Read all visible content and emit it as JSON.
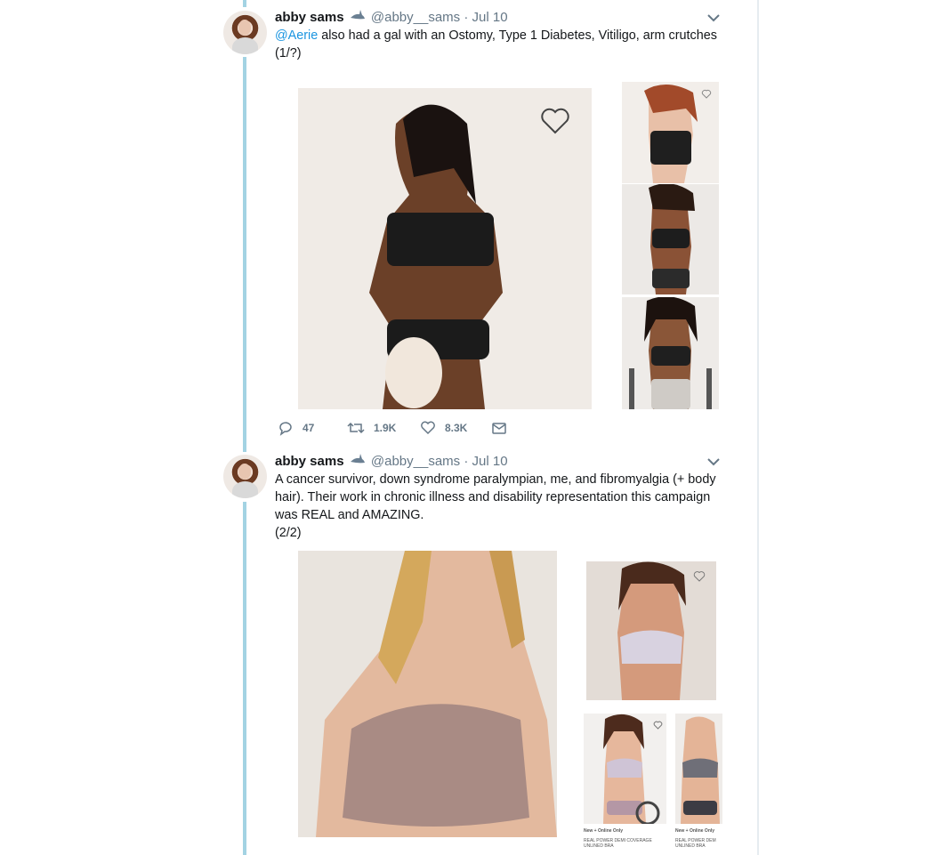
{
  "tweets": [
    {
      "name": "abby sams",
      "emoji": "shark-emoji",
      "handle": "@abby__sams",
      "separator": "·",
      "date": "Jul 10",
      "mention": "@Aerie",
      "text_after_mention": " also had a gal with an Ostomy, Type 1 Diabetes, Vitiligo, arm crutches",
      "text_line2": "(1/?)",
      "actions": {
        "replies": "47",
        "retweets": "1.9K",
        "likes": "8.3K"
      }
    },
    {
      "name": "abby sams",
      "emoji": "shark-emoji",
      "handle": "@abby__sams",
      "separator": "·",
      "date": "Jul 10",
      "text_lines": [
        "A cancer survivor, down syndrome paralympian, me, and fibromyalgia (+ body",
        "hair). Their work in chronic illness and disability representation this campaign",
        "was REAL and AMAZING.",
        "(2/2)"
      ],
      "captions": {
        "left_label": "New + Online Only",
        "left_product_1": "REAL POWER DEMI COVERAGE",
        "left_product_2": "UNLINED BRA",
        "right_label": "New + Online Only",
        "right_product_1": "REAL POWER DEM",
        "right_product_2": "UNLINED BRA"
      }
    }
  ],
  "colors": {
    "thread_line": "#a3d3e3",
    "mention": "#1b95e0",
    "meta_gray": "#657786"
  }
}
